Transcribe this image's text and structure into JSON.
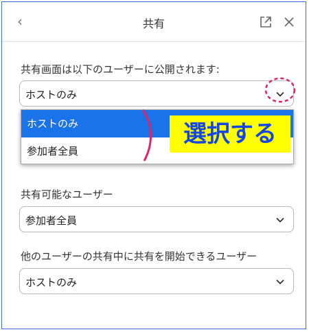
{
  "header": {
    "title": "共有",
    "back_icon": "chevron-left-icon",
    "popout_icon": "external-link-icon",
    "close_icon": "close-icon"
  },
  "section1": {
    "label": "共有画面は以下のユーザーに公開されます:",
    "selected_value": "ホストのみ",
    "dropdown_options": [
      "ホストのみ",
      "参加者全員"
    ]
  },
  "section2": {
    "label": "共有可能なユーザー",
    "selected_value": "参加者全員"
  },
  "section3": {
    "label": "他のユーザーの共有中に共有を開始できるユーザー",
    "selected_value": "ホストのみ"
  },
  "annotation": {
    "text": "選択する",
    "box_color": "#ffff00",
    "text_color": "#1446e6",
    "mark_color": "#e0246c"
  },
  "colors": {
    "selected_option_bg": "#1a73e8",
    "frame_border": "#3b6fe0"
  }
}
